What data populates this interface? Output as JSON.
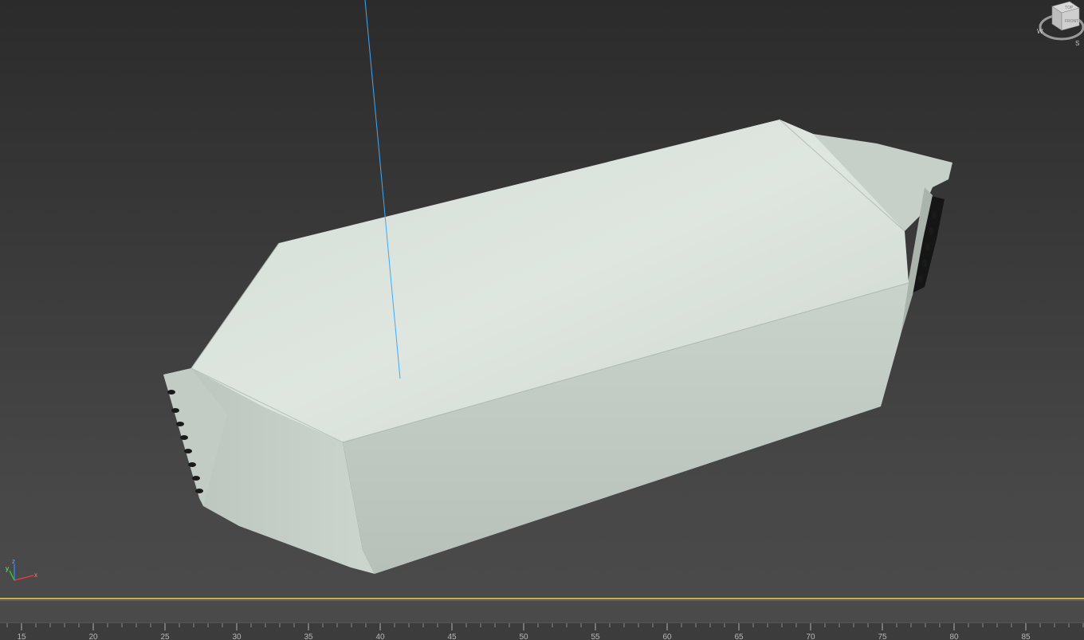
{
  "viewport": {
    "object": "package-mesh",
    "background_top": "#2b2b2b",
    "background_bottom": "#4a4a4a",
    "guide_line_color": "#3fa9f5"
  },
  "viewcube": {
    "face_top": "TOP",
    "face_front": "FRONT",
    "compass_w": "W",
    "compass_s": "S"
  },
  "axis_tripod": {
    "x": "x",
    "y": "y",
    "z": "z"
  },
  "trackbar": {
    "accent_color": "#c8b24a"
  },
  "timeline": {
    "tick_labels": [
      "15",
      "20",
      "25",
      "30",
      "35",
      "40",
      "45",
      "50",
      "55",
      "60",
      "65",
      "70",
      "75",
      "80",
      "85"
    ]
  }
}
